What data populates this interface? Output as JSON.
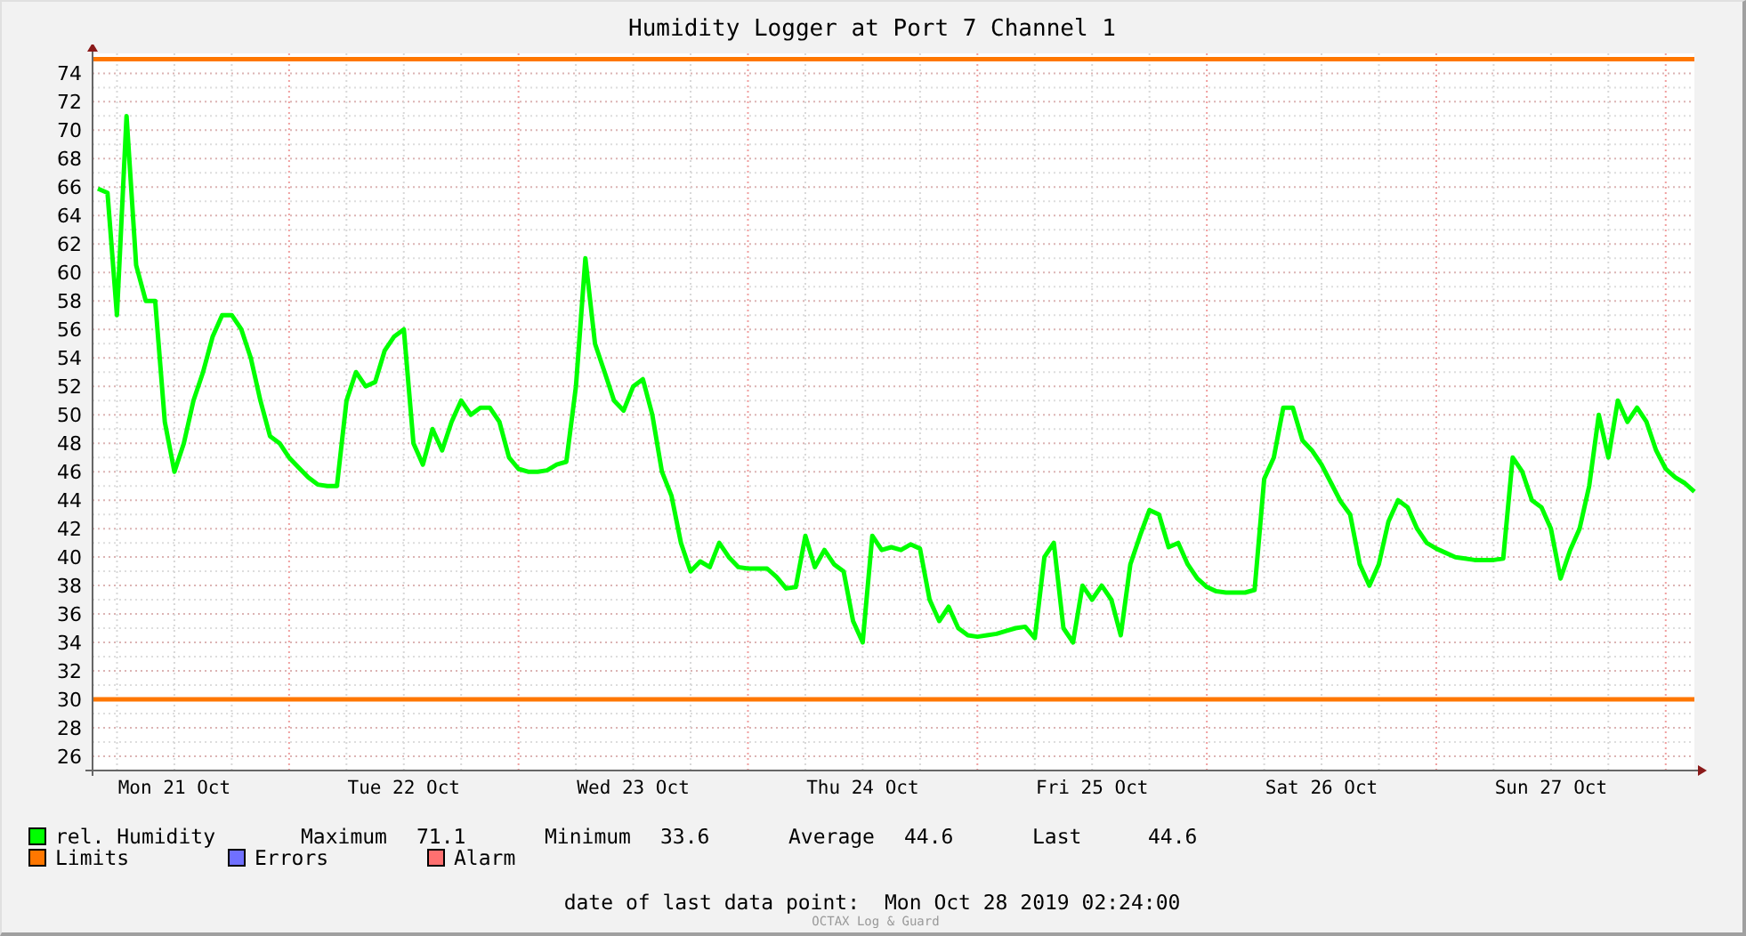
{
  "title": "Humidity Logger at Port 7 Channel 1",
  "chart_data": {
    "type": "line",
    "ylim": [
      25,
      75.4
    ],
    "yticks": [
      26,
      28,
      30,
      32,
      34,
      36,
      38,
      40,
      42,
      44,
      46,
      48,
      50,
      52,
      54,
      56,
      58,
      60,
      62,
      64,
      66,
      68,
      70,
      72,
      74
    ],
    "categories": [
      null,
      null,
      null,
      null,
      null,
      null,
      null,
      null,
      "Mon 21 Oct",
      null,
      null,
      null,
      null,
      null,
      null,
      null,
      null,
      null,
      null,
      null,
      null,
      null,
      null,
      null,
      null,
      null,
      null,
      null,
      null,
      null,
      null,
      null,
      "Tue 22 Oct",
      null,
      null,
      null,
      null,
      null,
      null,
      null,
      null,
      null,
      null,
      null,
      null,
      null,
      null,
      null,
      null,
      null,
      null,
      null,
      null,
      null,
      null,
      null,
      "Wed 23 Oct",
      null,
      null,
      null,
      null,
      null,
      null,
      null,
      null,
      null,
      null,
      null,
      null,
      null,
      null,
      null,
      null,
      null,
      null,
      null,
      null,
      null,
      null,
      null,
      "Thu 24 Oct",
      null,
      null,
      null,
      null,
      null,
      null,
      null,
      null,
      null,
      null,
      null,
      null,
      null,
      null,
      null,
      null,
      null,
      null,
      null,
      null,
      null,
      null,
      null,
      "Fri 25 Oct",
      null,
      null,
      null,
      null,
      null,
      null,
      null,
      null,
      null,
      null,
      null,
      null,
      null,
      null,
      null,
      null,
      null,
      null,
      null,
      null,
      null,
      null,
      null,
      "Sat 26 Oct",
      null,
      null,
      null,
      null,
      null,
      null,
      null,
      null,
      null,
      null,
      null,
      null,
      null,
      null,
      null,
      null,
      null,
      null,
      null,
      null,
      null,
      null,
      null,
      "Sun 27 Oct",
      null,
      null,
      null,
      null,
      null,
      null,
      null,
      null,
      null,
      null,
      null,
      null,
      null,
      null,
      null
    ],
    "series": [
      {
        "name": "rel. Humidity",
        "color": "#00ff00",
        "values": [
          65.9,
          65.6,
          57,
          71,
          60.5,
          58,
          58,
          49.5,
          46,
          48,
          51,
          53,
          55.5,
          57,
          57,
          56,
          54,
          51,
          48.5,
          48,
          47,
          46.3,
          45.6,
          45.1,
          45,
          45,
          51,
          53,
          52,
          52.3,
          54.5,
          55.5,
          56,
          48,
          46.5,
          49,
          47.5,
          49.5,
          51,
          50,
          50.5,
          50.5,
          49.5,
          47,
          46.2,
          46,
          46,
          46.1,
          46.5,
          46.7,
          52,
          61,
          55,
          53,
          51,
          50.3,
          52,
          52.5,
          50,
          46,
          44.3,
          41,
          39,
          39.7,
          39.3,
          41,
          40,
          39.3,
          39.2,
          39.2,
          39.2,
          38.6,
          37.8,
          37.9,
          41.5,
          39.3,
          40.5,
          39.5,
          39,
          35.5,
          34,
          41.5,
          40.5,
          40.7,
          40.5,
          40.9,
          40.6,
          37,
          35.5,
          36.5,
          35,
          34.5,
          34.4,
          34.5,
          34.6,
          34.8,
          35,
          35.1,
          34.3,
          40,
          41,
          35,
          34,
          38,
          37,
          38,
          37,
          34.5,
          39.5,
          41.5,
          43.3,
          43,
          40.7,
          41,
          39.5,
          38.5,
          37.9,
          37.6,
          37.5,
          37.5,
          37.5,
          37.7,
          45.5,
          47,
          50.5,
          50.5,
          48.2,
          47.5,
          46.5,
          45.2,
          43.9,
          43,
          39.5,
          38,
          39.5,
          42.5,
          44,
          43.5,
          42,
          41,
          40.6,
          40.3,
          40,
          39.9,
          39.8,
          39.8,
          39.8,
          39.9,
          47,
          46,
          44,
          43.5,
          42,
          38.5,
          40.5,
          42,
          45,
          50,
          47,
          51,
          49.5,
          50.5,
          49.5,
          47.5,
          46.2,
          45.6,
          45.2,
          44.6
        ]
      }
    ],
    "grid": true,
    "ref_lines": [
      {
        "axis": "y",
        "value": 75,
        "color": "#ff7700"
      },
      {
        "axis": "y",
        "value": 30,
        "color": "#ff7700"
      }
    ]
  },
  "legend": [
    {
      "label": "Limits",
      "color": "#ff7700"
    },
    {
      "label": "Errors",
      "color": "#7070ff"
    },
    {
      "label": "Alarm",
      "color": "#ff7070"
    }
  ],
  "stats": [
    {
      "label": "Maximum",
      "value": "71.1"
    },
    {
      "label": "Minimum",
      "value": "33.6"
    },
    {
      "label": "Average",
      "value": "44.6"
    },
    {
      "label": "Last",
      "value": "44.6"
    }
  ],
  "last_data_point": {
    "label": "date of last data point:",
    "value": "Mon Oct 28 2019 02:24:00"
  },
  "footer": "OCTAX Log & Guard"
}
